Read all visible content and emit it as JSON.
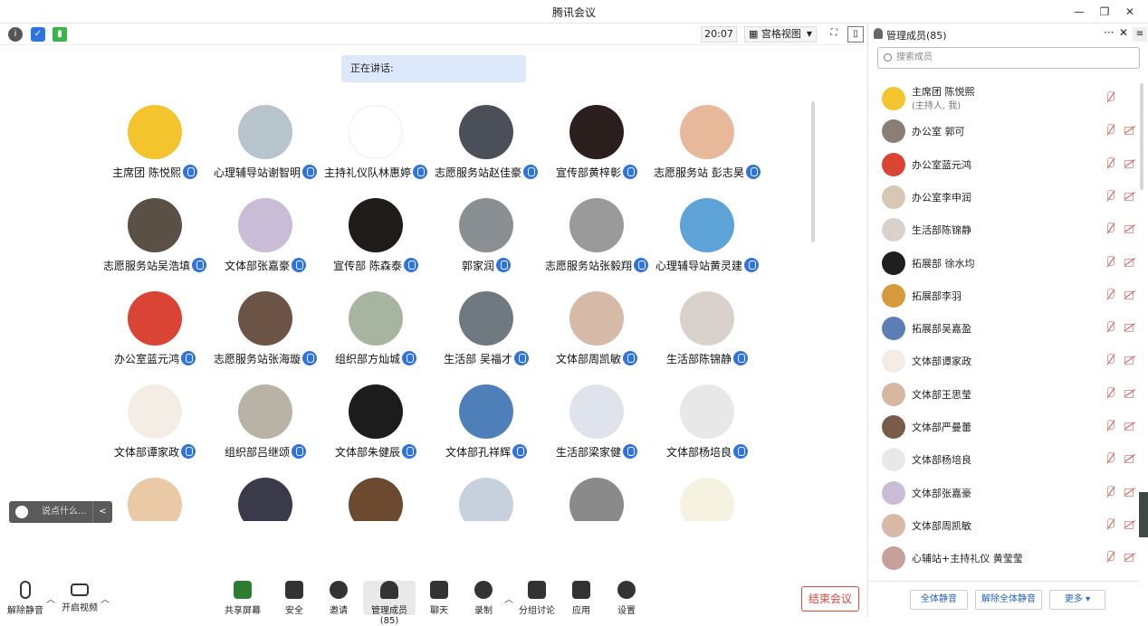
{
  "window": {
    "title": "腾讯会议",
    "controls": [
      "—",
      "❐",
      "✕"
    ]
  },
  "toolbar": {
    "time": "20:07",
    "view_label": "宫格视图"
  },
  "speaking": {
    "label": "正在讲话:"
  },
  "participants": [
    {
      "name": "主席团 陈悦熙",
      "color": "#f4c42e",
      "host": true
    },
    {
      "name": "心理辅导站谢智明",
      "color": "#b8c4cc"
    },
    {
      "name": "主持礼仪队林惠婷",
      "color": "#ffffff"
    },
    {
      "name": "志愿服务站赵佳豪",
      "color": "#4a4f58"
    },
    {
      "name": "宣传部黄梓彰",
      "color": "#2b1f1d"
    },
    {
      "name": "志愿服务站 彭志昊",
      "color": "#e7b99a"
    },
    {
      "name": "志愿服务站吴浩填",
      "color": "#5a5046"
    },
    {
      "name": "文体部张嘉豪",
      "color": "#c9bcd6"
    },
    {
      "name": "宣传部 陈森泰",
      "color": "#1f1b18"
    },
    {
      "name": "郭家润",
      "color": "#8a8f94"
    },
    {
      "name": "志愿服务站张毅翔",
      "color": "#9a9a9a"
    },
    {
      "name": "心理辅导站黄灵建",
      "color": "#5ea3d8"
    },
    {
      "name": "办公室蓝元鸿",
      "color": "#d94434"
    },
    {
      "name": "志愿服务站张海璇",
      "color": "#6b5446"
    },
    {
      "name": "组织部方灿城",
      "color": "#a7b5a0"
    },
    {
      "name": "生活部 吴福才",
      "color": "#6f7a80"
    },
    {
      "name": "文体部周凯敏",
      "color": "#d7b9a8"
    },
    {
      "name": "生活部陈锦静",
      "color": "#d9d2cc"
    },
    {
      "name": "文体部谭家政",
      "color": "#f3ede6"
    },
    {
      "name": "组织部吕继颂",
      "color": "#b9b2a6"
    },
    {
      "name": "文体部朱健辰",
      "color": "#1c1c1c"
    },
    {
      "name": "文体部孔祥辉",
      "color": "#4f7fb8"
    },
    {
      "name": "生活部梁家健",
      "color": "#dfe3ec"
    },
    {
      "name": "文体部杨培良",
      "color": "#e8e8e8"
    },
    {
      "name": "",
      "color": "#e9c9a6"
    },
    {
      "name": "",
      "color": "#3a3a4a"
    },
    {
      "name": "",
      "color": "#6b4a30"
    },
    {
      "name": "",
      "color": "#c7d1de"
    },
    {
      "name": "",
      "color": "#8a8a8a"
    },
    {
      "name": "",
      "color": "#f6f2e2"
    }
  ],
  "chat": {
    "placeholder": "说点什么...",
    "collapse": "<"
  },
  "bottom": {
    "unmute": "解除静音",
    "video": "开启视频",
    "share": "共享屏幕",
    "security": "安全",
    "invite": "邀请",
    "manage": "管理成员(85)",
    "chat": "聊天",
    "record": "录制",
    "breakout": "分组讨论",
    "apps": "应用",
    "settings": "设置",
    "end": "结束会议"
  },
  "panel": {
    "title": "管理成员(85)",
    "more": "···",
    "close": "✕",
    "menu": "≡",
    "search_placeholder": "搜索成员",
    "members": [
      {
        "name": "主席团 陈悦熙",
        "sub": "(主持人, 我)",
        "color": "#f4c42e"
      },
      {
        "name": "办公室 郭可",
        "color": "#8c7e74"
      },
      {
        "name": "办公室蓝元鸿",
        "color": "#d94434"
      },
      {
        "name": "办公室李申润",
        "color": "#d8c7b5"
      },
      {
        "name": "生活部陈锦静",
        "color": "#d9d2cc"
      },
      {
        "name": "拓展部 徐水均",
        "color": "#1f1f1f"
      },
      {
        "name": "拓展部李羽",
        "color": "#d59a3c"
      },
      {
        "name": "拓展部吴嘉盈",
        "color": "#5b7fb4"
      },
      {
        "name": "文体部谭家政",
        "color": "#f3ede6"
      },
      {
        "name": "文体部王思莹",
        "color": "#d6b8a2"
      },
      {
        "name": "文体部严曼蕾",
        "color": "#7a5a48"
      },
      {
        "name": "文体部杨培良",
        "color": "#e8e8e8"
      },
      {
        "name": "文体部张嘉豪",
        "color": "#c9bcd6"
      },
      {
        "name": "文体部周凯敏",
        "color": "#d7b9a8"
      },
      {
        "name": "心辅站+主持礼仪 黄莹莹",
        "color": "#c7a09a"
      }
    ],
    "mute_all": "全体静音",
    "unmute_all": "解除全体静音",
    "more_btn": "更多 ▾"
  },
  "colors": {
    "accent": "#2f73e0",
    "danger": "#e0453a"
  }
}
